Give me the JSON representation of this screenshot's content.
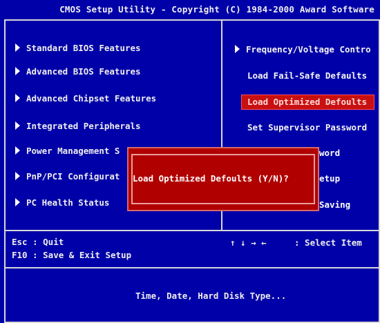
{
  "title": "CMOS Setup Utility - Copyright (C) 1984-2000 Award Software",
  "left_menu": [
    {
      "label": "Standard BIOS Features"
    },
    {
      "label": "Advanced BIOS Features"
    },
    {
      "label": "Advanced Chipset Features"
    },
    {
      "label": "Integrated Peripherals"
    },
    {
      "label": "Power Management S"
    },
    {
      "label": "PnP/PCI Configurat"
    },
    {
      "label": "PC Health Status"
    }
  ],
  "right_menu": [
    {
      "label": "Frequency/Voltage Contro"
    },
    {
      "label": "Load Fail-Safe Defaults"
    },
    {
      "label": "Load Optimized Defoults"
    },
    {
      "label": "Set Supervisor Password"
    },
    {
      "label": "word"
    },
    {
      "label": "etup"
    },
    {
      "label": "Saving"
    }
  ],
  "dialog": {
    "prompt": "Load Optimized Defoults (Y/N)?"
  },
  "keys": {
    "esc": "Esc : Quit",
    "f10": "F10 : Save & Exit Setup",
    "arrows": "↑ ↓ → ←",
    "select": ": Select Item"
  },
  "help": "Time, Date, Hard Disk Type..."
}
